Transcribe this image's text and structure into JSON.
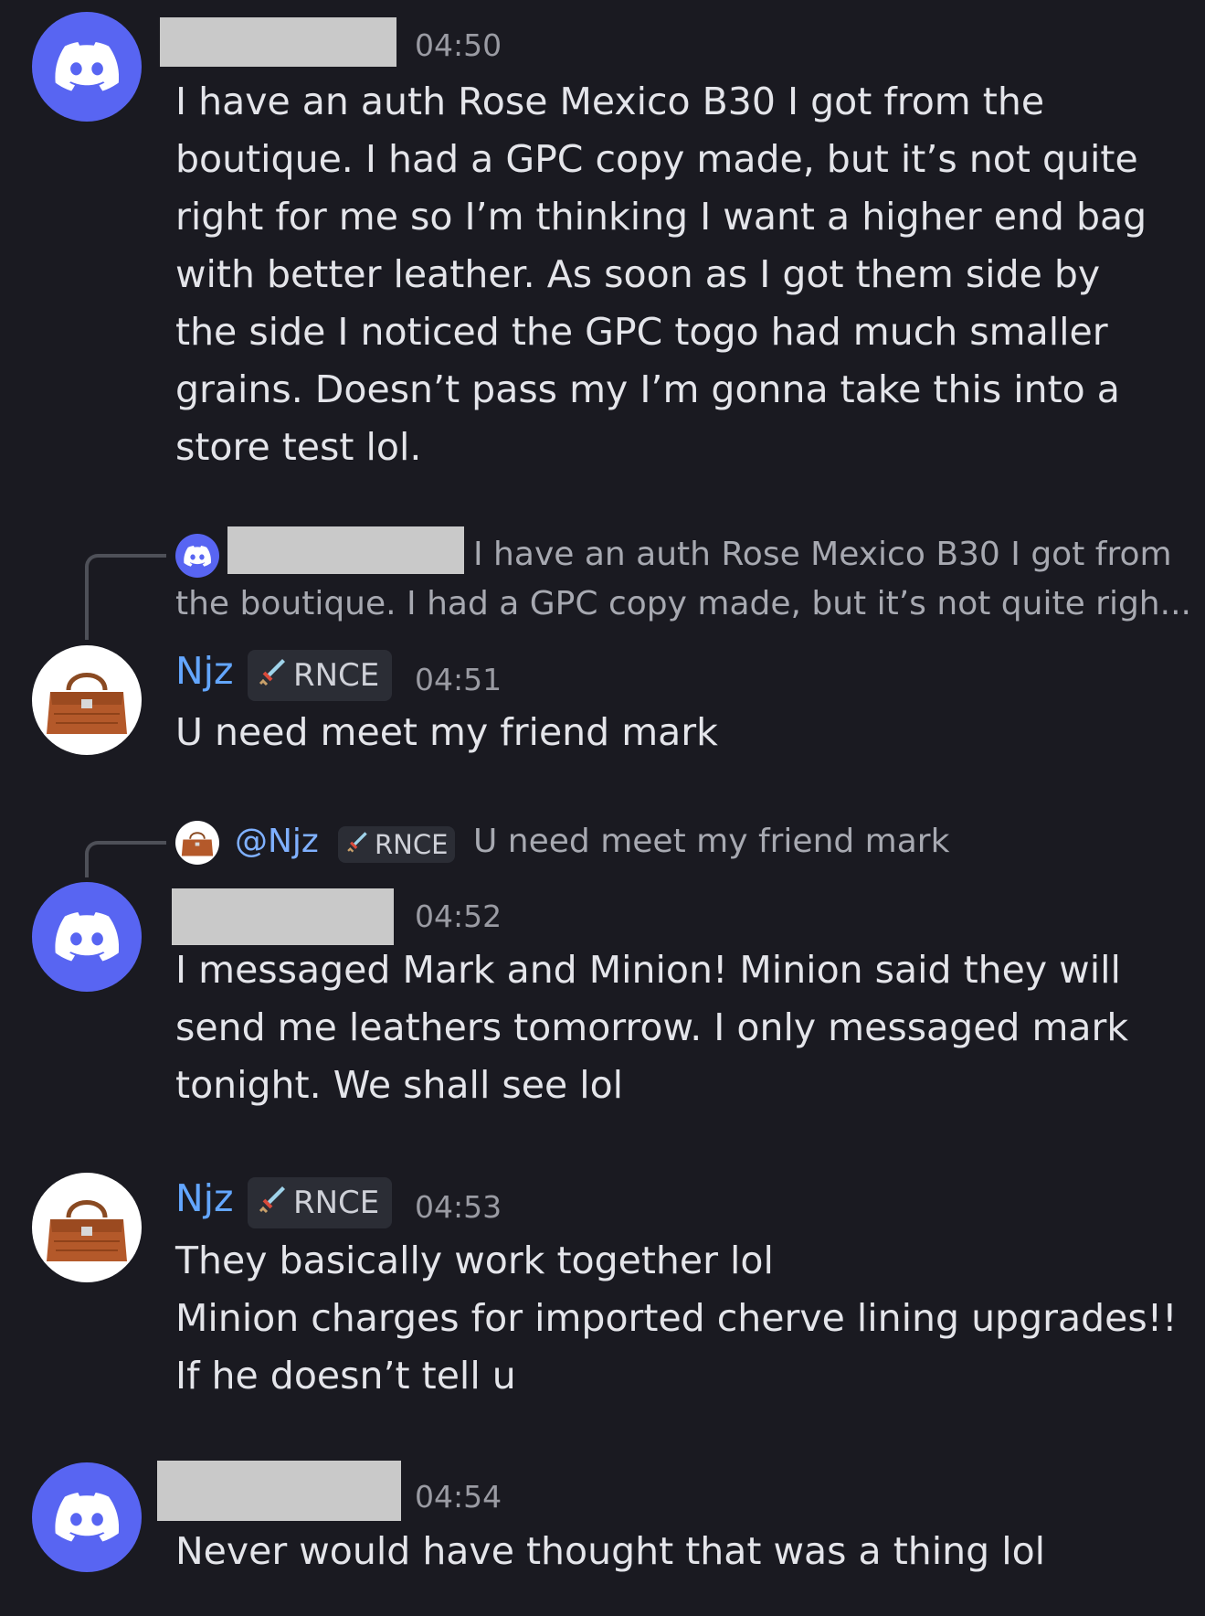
{
  "messages": {
    "m1": {
      "timestamp": "04:50",
      "text": "I have an auth Rose Mexico B30 I got from the boutique. I had a GPC copy made, but it’s not quite right for me so I’m thinking I want a higher end bag with better leather. As soon as I got them side by the side I noticed the GPC togo had much smaller grains. Doesn’t pass my I’m gonna take this into a store test lol."
    },
    "m2": {
      "reply_line1": "I have an auth Rose Mexico B30 I got from",
      "reply_line2": "the boutique. I had a GPC copy made, but it’s not quite righ...",
      "author": "Njz",
      "badge": "RNCE",
      "timestamp": "04:51",
      "text": "U need meet my friend mark"
    },
    "m3": {
      "reply_mention": "@Njz",
      "reply_badge": "RNCE",
      "reply_text": "U need meet my friend mark",
      "timestamp": "04:52",
      "text": "I messaged Mark and Minion! Minion said they will send me leathers tomorrow. I only messaged mark tonight. We shall see lol"
    },
    "m4": {
      "author": "Njz",
      "badge": "RNCE",
      "timestamp": "04:53",
      "text": "They basically work together lol\nMinion charges for imported cherve lining upgrades!!\nIf he doesn’t tell u"
    },
    "m5": {
      "timestamp": "04:54",
      "text": "Never would have thought that was a thing lol"
    }
  },
  "colors": {
    "background": "#1a1a21",
    "discord_blurple": "#5865f2",
    "username_blue": "#63a6ff",
    "timestamp_gray": "#9a9ba3",
    "redaction_gray": "#c9c9c9"
  },
  "icons": {
    "default_avatar": "discord-logo-icon",
    "njz_avatar": "birkin-bag-icon",
    "role_badge": "sword-icon"
  }
}
